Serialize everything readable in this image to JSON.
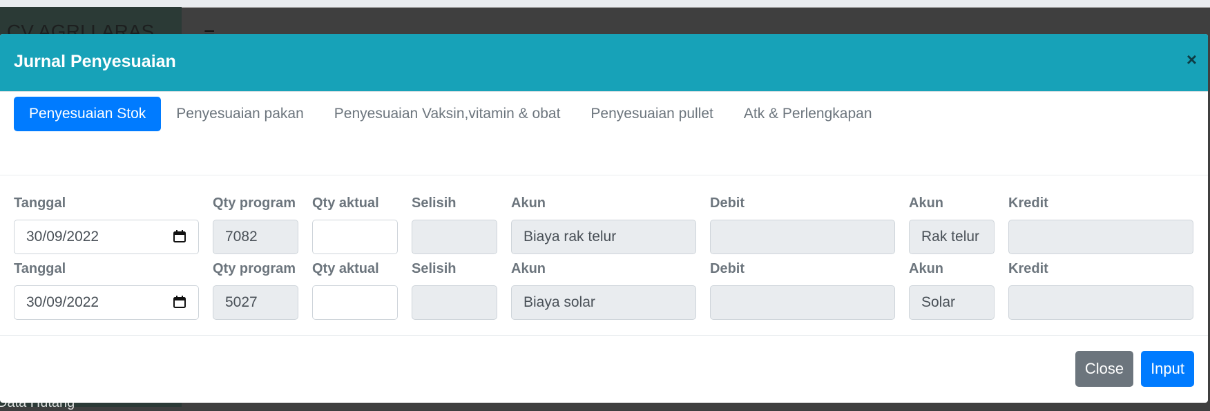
{
  "background": {
    "brand_partial": "CV AGRI LARAS",
    "hamburger_glyph": "≡",
    "bottom_partial": "Data Hutang"
  },
  "modal": {
    "title": "Jurnal Penyesuaian",
    "close_glyph": "×",
    "header_color": "#17a2b8",
    "tabs": [
      {
        "label": "Penyesuaian Stok",
        "active": true
      },
      {
        "label": "Penyesuaian pakan",
        "active": false
      },
      {
        "label": "Penyesuaian Vaksin,vitamin & obat",
        "active": false
      },
      {
        "label": "Penyesuaian pullet",
        "active": false
      },
      {
        "label": "Atk & Perlengkapan",
        "active": false
      }
    ],
    "labels": {
      "tanggal": "Tanggal",
      "qty_program": "Qty program",
      "qty_aktual": "Qty aktual",
      "selisih": "Selisih",
      "akun": "Akun",
      "debit": "Debit",
      "akun2": "Akun",
      "kredit": "Kredit"
    },
    "rows": [
      {
        "tanggal": "30/09/2022",
        "qty_program": "7082",
        "qty_aktual": "",
        "selisih": "",
        "akun_debit": "Biaya rak telur",
        "debit": "",
        "akun_kredit": "Rak telur",
        "kredit": ""
      },
      {
        "tanggal": "30/09/2022",
        "qty_program": "5027",
        "qty_aktual": "",
        "selisih": "",
        "akun_debit": "Biaya solar",
        "debit": "",
        "akun_kredit": "Solar",
        "kredit": ""
      }
    ],
    "buttons": {
      "close": "Close",
      "input": "Input"
    }
  }
}
